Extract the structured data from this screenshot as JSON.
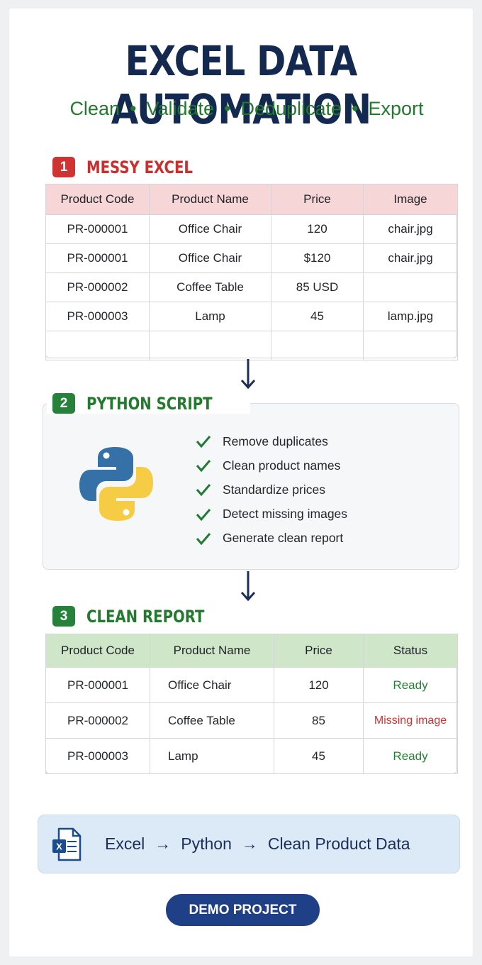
{
  "header": {
    "title": "EXCEL DATA AUTOMATION",
    "steps": [
      "Clean",
      "Validate",
      "Deduplicate",
      "Export"
    ]
  },
  "sections": {
    "messy": {
      "number": "1",
      "title": "MESSY EXCEL"
    },
    "script": {
      "number": "2",
      "title": "PYTHON SCRIPT"
    },
    "clean": {
      "number": "3",
      "title": "CLEAN REPORT"
    }
  },
  "messy_table": {
    "columns": [
      "Product Code",
      "Product Name",
      "Price",
      "Image"
    ],
    "rows": [
      [
        "PR-000001",
        "Office Chair",
        "120",
        "chair.jpg"
      ],
      [
        "PR-000001",
        "Office Chair",
        "$120",
        "chair.jpg"
      ],
      [
        "PR-000002",
        "Coffee Table",
        "85 USD",
        ""
      ],
      [
        "PR-000003",
        "Lamp",
        "45",
        "lamp.jpg"
      ],
      [
        "",
        "",
        "",
        ""
      ]
    ]
  },
  "script_steps": [
    "Remove duplicates",
    "Clean product names",
    "Standardize prices",
    "Detect missing images",
    "Generate clean report"
  ],
  "clean_table": {
    "columns": [
      "Product Code",
      "Product Name",
      "Price",
      "Status"
    ],
    "rows": [
      [
        "PR-000001",
        "Office Chair",
        "120",
        "Ready"
      ],
      [
        "PR-000002",
        "Coffee Table",
        "85",
        "Missing image"
      ],
      [
        "PR-000003",
        "Lamp",
        "45",
        "Ready"
      ]
    ]
  },
  "flow": {
    "parts": [
      "Excel",
      "Python",
      "Clean Product Data"
    ],
    "separator": "→"
  },
  "button": {
    "label": "DEMO PROJECT"
  },
  "colors": {
    "title": "#13294f",
    "accent_green": "#237a2e",
    "accent_red": "#cf3433",
    "button": "#1f3f87"
  },
  "icons": {
    "script": "python-logo-icon",
    "check": "check-icon",
    "arrow": "arrow-down-icon",
    "excel": "excel-file-icon"
  }
}
